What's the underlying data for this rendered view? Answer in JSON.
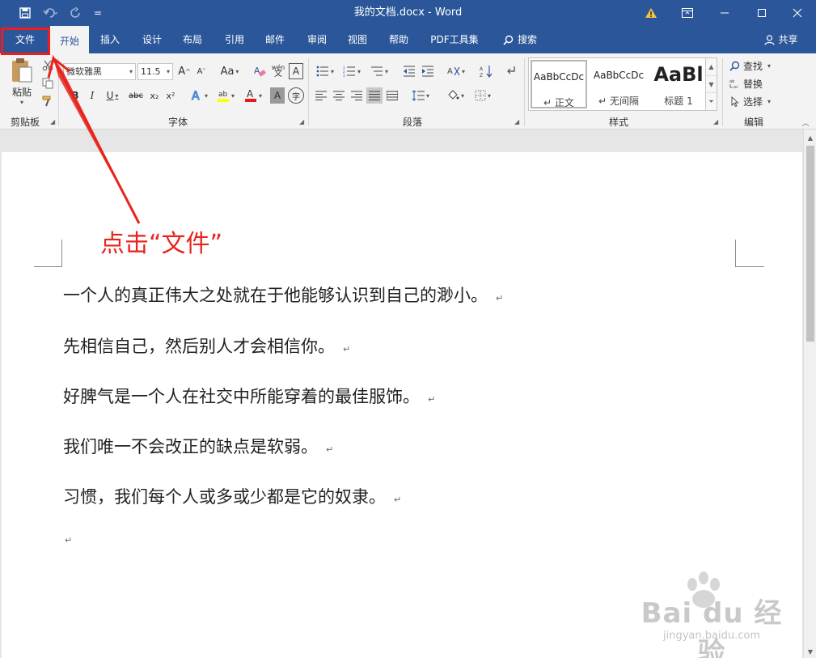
{
  "window": {
    "title": "我的文档.docx - Word"
  },
  "quick_access": {
    "customize_label": "="
  },
  "tabs": {
    "file": "文件",
    "home": "开始",
    "insert": "插入",
    "design": "设计",
    "layout": "布局",
    "references": "引用",
    "mailings": "邮件",
    "review": "审阅",
    "view": "视图",
    "help": "帮助",
    "pdf": "PDF工具集",
    "search": "搜索",
    "share": "共享"
  },
  "ribbon": {
    "clipboard": {
      "paste": "粘贴",
      "label": "剪贴板"
    },
    "font": {
      "name": "微软雅黑",
      "size": "11.5",
      "label": "字体",
      "bold": "B",
      "italic": "I",
      "underline": "U",
      "strike": "abc",
      "subscript": "x₂",
      "superscript": "x²",
      "grow": "A",
      "shrink": "A",
      "case": "Aa",
      "phonetic": "wén",
      "border_char": "A",
      "shade_char": "A",
      "enclose": "字"
    },
    "paragraph": {
      "label": "段落"
    },
    "styles": {
      "label": "样式",
      "items": [
        {
          "sample": "AaBbCcDc",
          "name": "正文"
        },
        {
          "sample": "AaBbCcDc",
          "name": "无间隔"
        },
        {
          "sample": "AaBl",
          "name": "标题 1"
        }
      ]
    },
    "editing": {
      "label": "编辑",
      "find": "查找",
      "replace": "替换",
      "select": "选择"
    }
  },
  "document": {
    "paragraphs": [
      "一个人的真正伟大之处就在于他能够认识到自己的渺小。",
      "先相信自己，然后别人才会相信你。",
      "好脾气是一个人在社交中所能穿着的最佳服饰。",
      "我们唯一不会改正的缺点是软弱。",
      "习惯，我们每个人或多或少都是它的奴隶。"
    ],
    "paragraph_mark": "↵"
  },
  "annotation": {
    "text": "点击“文件”",
    "color": "#e8231d"
  },
  "watermark": {
    "brand": "Bai du 经验",
    "url": "jingyan.baidu.com"
  },
  "colors": {
    "accent": "#2b579a",
    "ribbon_bg": "#f3f3f3",
    "highlight_red": "#ee1c1c"
  }
}
